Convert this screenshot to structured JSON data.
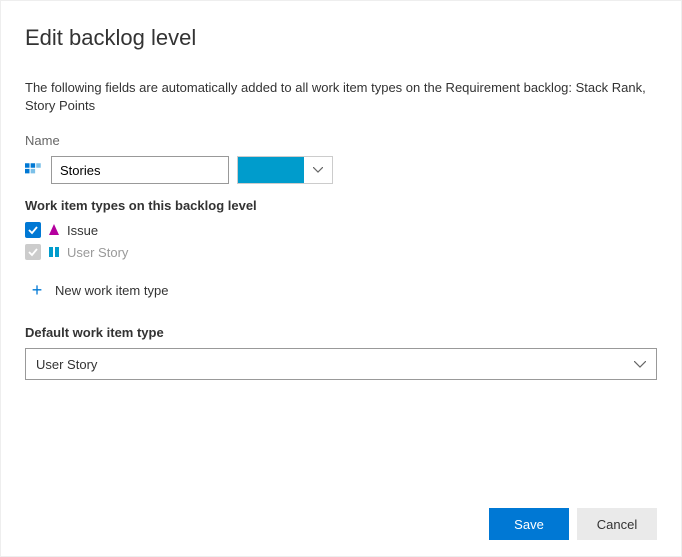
{
  "title": "Edit backlog level",
  "description": "The following fields are automatically added to all work item types on the Requirement backlog: Stack Rank, Story Points",
  "name": {
    "label": "Name",
    "value": "Stories",
    "color": "#009ccc"
  },
  "workItemTypes": {
    "label": "Work item types on this backlog level",
    "items": [
      {
        "label": "Issue",
        "checked": true,
        "disabled": false,
        "icon": "issue"
      },
      {
        "label": "User Story",
        "checked": true,
        "disabled": true,
        "icon": "userstory"
      }
    ],
    "addLabel": "New work item type"
  },
  "defaultType": {
    "label": "Default work item type",
    "value": "User Story"
  },
  "buttons": {
    "save": "Save",
    "cancel": "Cancel"
  }
}
